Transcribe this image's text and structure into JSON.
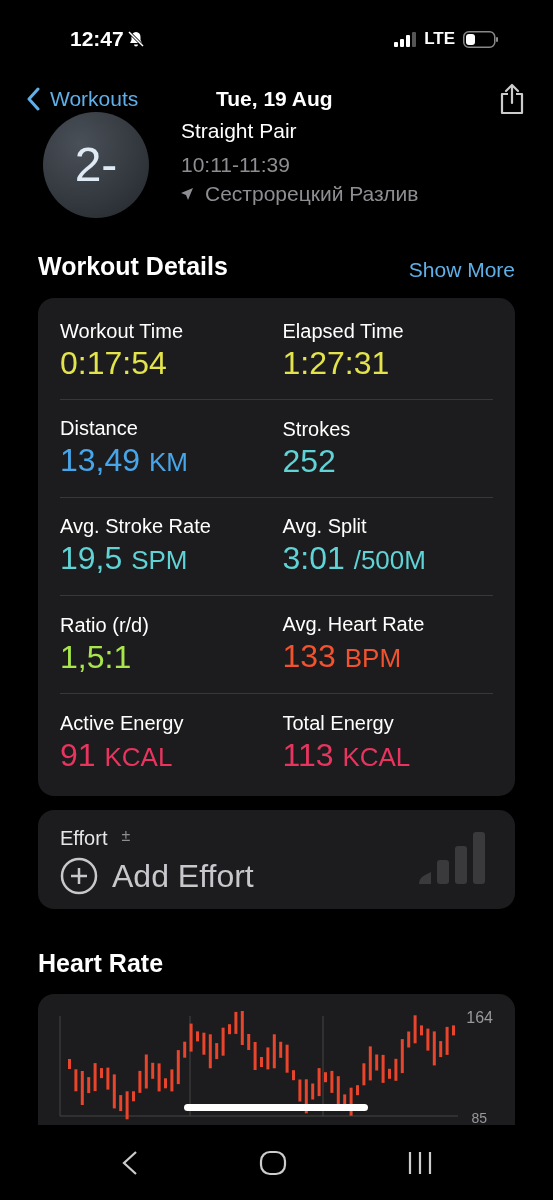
{
  "status_bar": {
    "time": "12:47",
    "network": "LTE"
  },
  "nav": {
    "back_label": "Workouts",
    "title": "Tue, 19 Aug"
  },
  "workout": {
    "badge": "2-",
    "name": "Straight Pair",
    "time_range": "10:11-11:39",
    "location": "Сестрорецкий Разлив"
  },
  "details": {
    "title": "Workout Details",
    "action": "Show More",
    "metrics": [
      {
        "label": "Workout Time",
        "value": "0:17:54",
        "color": "#e3e34c"
      },
      {
        "label": "Elapsed Time",
        "value": "1:27:31",
        "color": "#e3e34c"
      },
      {
        "label": "Distance",
        "value": "13,49",
        "unit": "KM",
        "color": "#47a6ea"
      },
      {
        "label": "Strokes",
        "value": "252",
        "color": "#5fd3d5"
      },
      {
        "label": "Avg. Stroke Rate",
        "value": "19,5",
        "unit": "SPM",
        "color": "#5fd3d5"
      },
      {
        "label": "Avg. Split",
        "value": "3:01",
        "unit": "/500M",
        "color": "#5fd3d5"
      },
      {
        "label": "Ratio (r/d)",
        "value": "1,5:1",
        "color": "#a8e64c"
      },
      {
        "label": "Avg. Heart Rate",
        "value": "133",
        "unit": "BPM",
        "color": "#f2522e"
      },
      {
        "label": "Active Energy",
        "value": "91",
        "unit": "KCAL",
        "color": "#e8345e"
      },
      {
        "label": "Total Energy",
        "value": "113",
        "unit": "KCAL",
        "color": "#e8345e"
      }
    ]
  },
  "effort": {
    "label": "Effort",
    "label_mark": "±",
    "action": "Add Effort"
  },
  "heart_rate": {
    "title": "Heart Rate",
    "axis_labels": [
      "164",
      "85"
    ]
  }
}
